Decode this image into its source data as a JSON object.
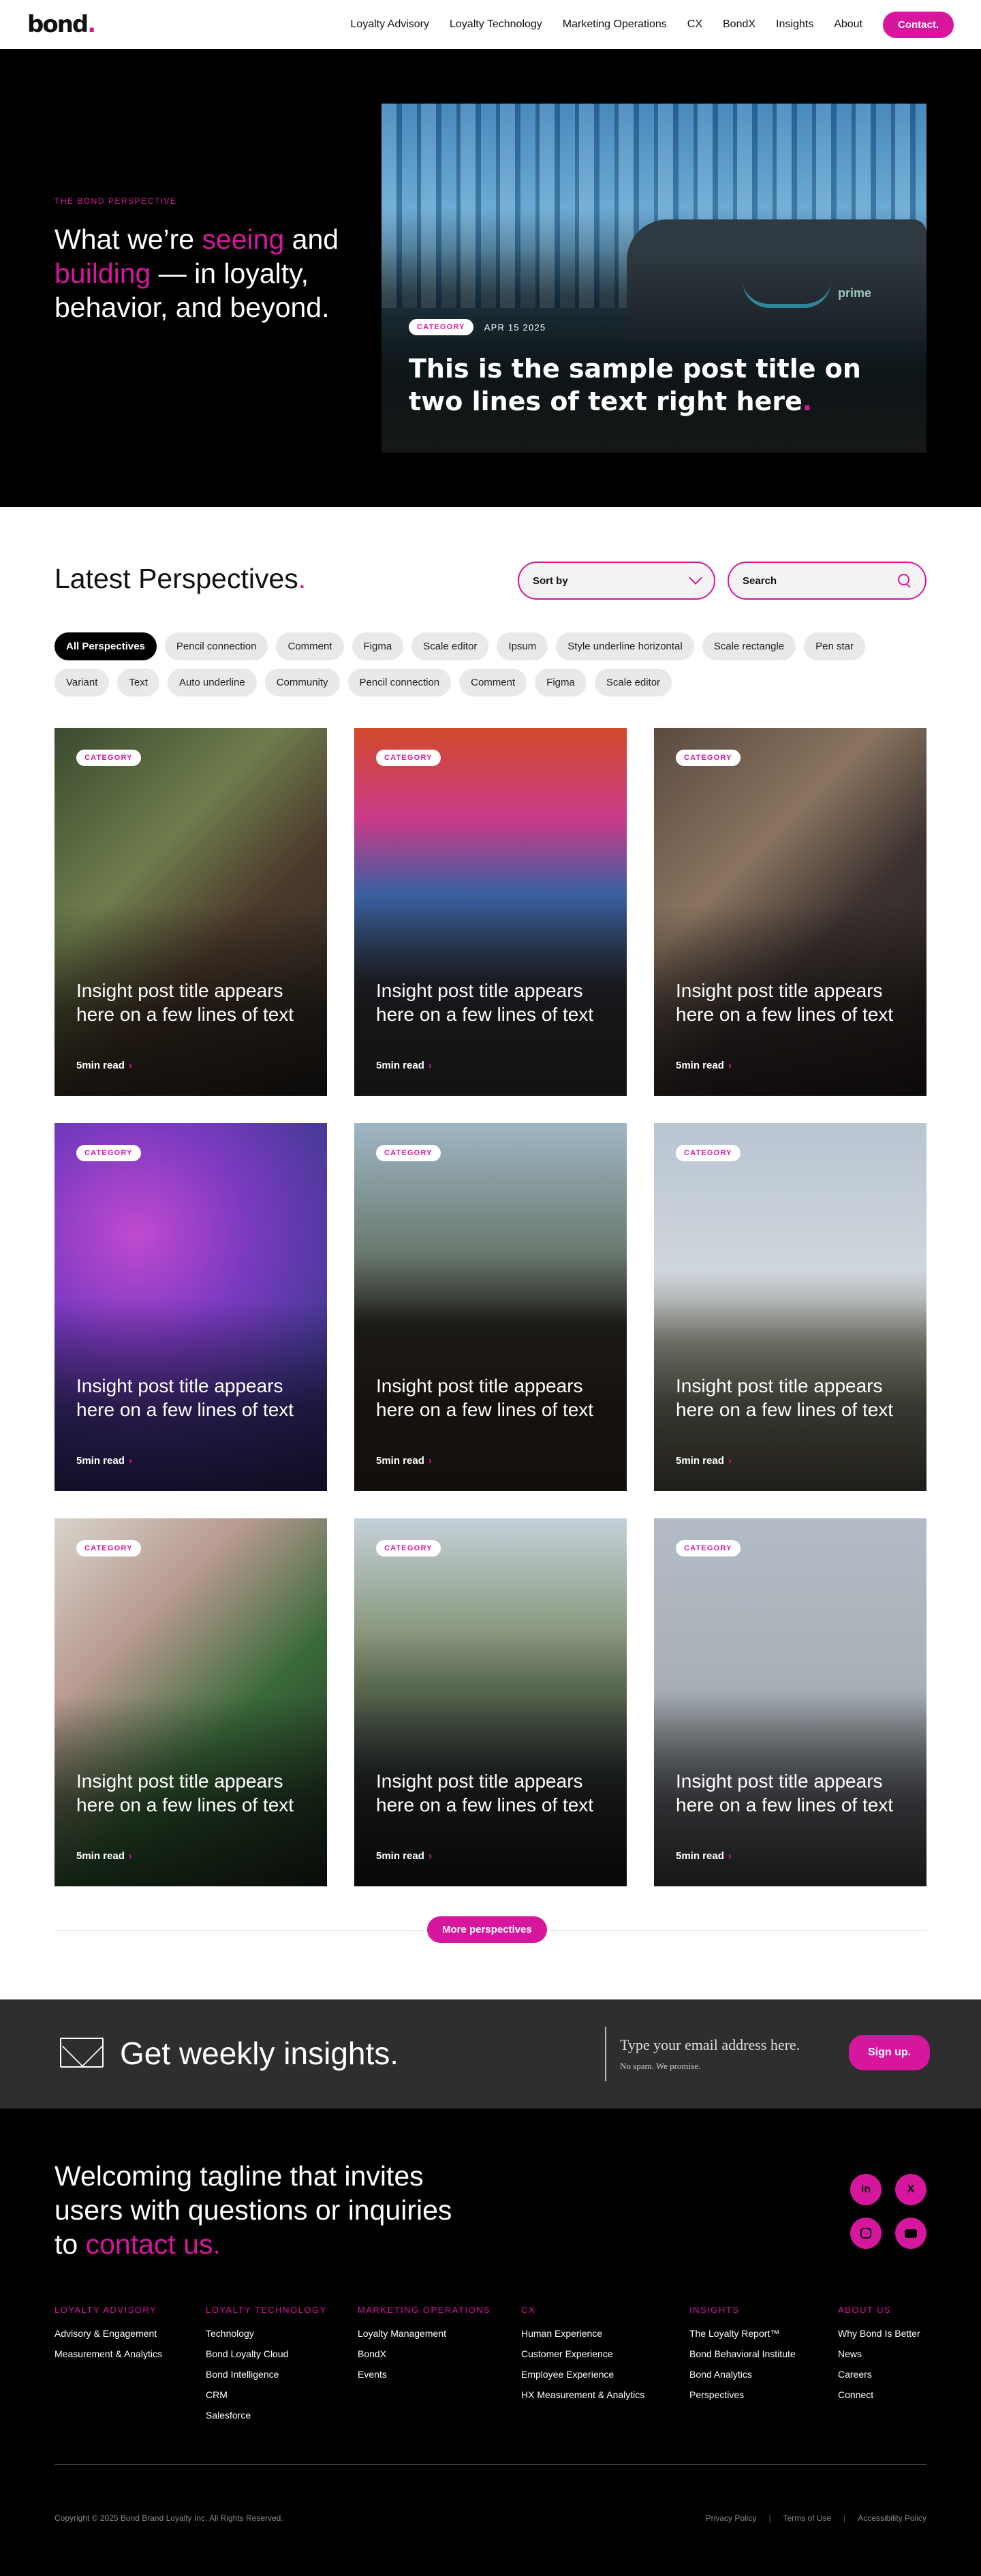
{
  "nav": {
    "logo": "bond",
    "links": [
      "Loyalty Advisory",
      "Loyalty Technology",
      "Marketing Operations",
      "CX",
      "BondX",
      "Insights",
      "About"
    ],
    "cta": "Contact."
  },
  "hero": {
    "eyebrow": "THE BOND PERSPECTIVE",
    "title_1": "What we’re ",
    "title_seeing": "seeing",
    "title_2": " and ",
    "title_building": "building",
    "title_3": " — in loyalty, behavior, and beyond.",
    "card": {
      "category": "CATEGORY",
      "date": "APR 15 2025",
      "title": "This is the sample post title on two lines of text right here",
      "van_text": "prime"
    }
  },
  "latest": {
    "title": "Latest Perspectives",
    "sort_label": "Sort by",
    "search_placeholder": "Search",
    "chips": [
      "All Perspectives",
      "Pencil connection",
      "Comment",
      "Figma",
      "Scale editor",
      "Ipsum",
      "Style underline horizontal",
      "Scale rectangle",
      "Pen star",
      "Variant",
      "Text",
      "Auto underline",
      "Community",
      "Pencil connection",
      "Comment",
      "Figma",
      "Scale editor"
    ],
    "active_chip": "All Perspectives",
    "cards": [
      {
        "category": "CATEGORY",
        "title": "Insight post title appears here on a few lines of text",
        "read": "5min read"
      },
      {
        "category": "CATEGORY",
        "title": "Insight post title appears here on a few lines of text",
        "read": "5min read"
      },
      {
        "category": "CATEGORY",
        "title": "Insight post title appears here on a few lines of text",
        "read": "5min read"
      },
      {
        "category": "CATEGORY",
        "title": "Insight post title appears here on a few lines of text",
        "read": "5min read"
      },
      {
        "category": "CATEGORY",
        "title": "Insight post title appears here on a few lines of text",
        "read": "5min read"
      },
      {
        "category": "CATEGORY",
        "title": "Insight post title appears here on a few lines of text",
        "read": "5min read"
      },
      {
        "category": "CATEGORY",
        "title": "Insight post title appears here on a few lines of text",
        "read": "5min read"
      },
      {
        "category": "CATEGORY",
        "title": "Insight post title appears here on a few lines of text",
        "read": "5min read"
      },
      {
        "category": "CATEGORY",
        "title": "Insight post title appears here on a few lines of text",
        "read": "5min read"
      }
    ],
    "more": "More perspectives"
  },
  "newsletter": {
    "title": "Get weekly insights.",
    "placeholder": "Type your email address here.",
    "sub": "No spam. We promise.",
    "cta": "Sign up."
  },
  "footer": {
    "tagline_1": "Welcoming tagline that invites users with questions or inquiries to ",
    "tagline_link": "contact us.",
    "socials": [
      "in",
      "X",
      "ig",
      "yt"
    ],
    "columns": [
      {
        "heading": "LOYALTY ADVISORY",
        "links": [
          "Advisory & Engagement",
          "Measurement & Analytics"
        ]
      },
      {
        "heading": "LOYALTY TECHNOLOGY",
        "links": [
          "Technology",
          "Bond Loyalty Cloud",
          "Bond Intelligence",
          "CRM",
          "Salesforce"
        ]
      },
      {
        "heading": "MARKETING OPERATIONS",
        "links": [
          "Loyalty Management",
          "BondX",
          "Events"
        ]
      },
      {
        "heading": "CX",
        "links": [
          "Human Experience",
          "Customer Experience",
          "Employee Experience",
          "HX Measurement & Analytics"
        ]
      },
      {
        "heading": "INSIGHTS",
        "links": [
          "The Loyalty Report™",
          "Bond Behavioral Institute",
          "Bond Analytics",
          "Perspectives"
        ]
      },
      {
        "heading": "ABOUT US",
        "links": [
          "Why Bond Is Better",
          "News",
          "Careers",
          "Connect"
        ]
      }
    ],
    "copyright": "Copyright © 2025 Bond Brand Loyalty Inc. All Rights Reserved.",
    "legal": [
      "Privacy Policy",
      "Terms of Use",
      "Accessibility Policy"
    ]
  },
  "colors": {
    "accent": "#d6179e",
    "dark": "#000000",
    "newsletter_bg": "#2e2d2f"
  }
}
